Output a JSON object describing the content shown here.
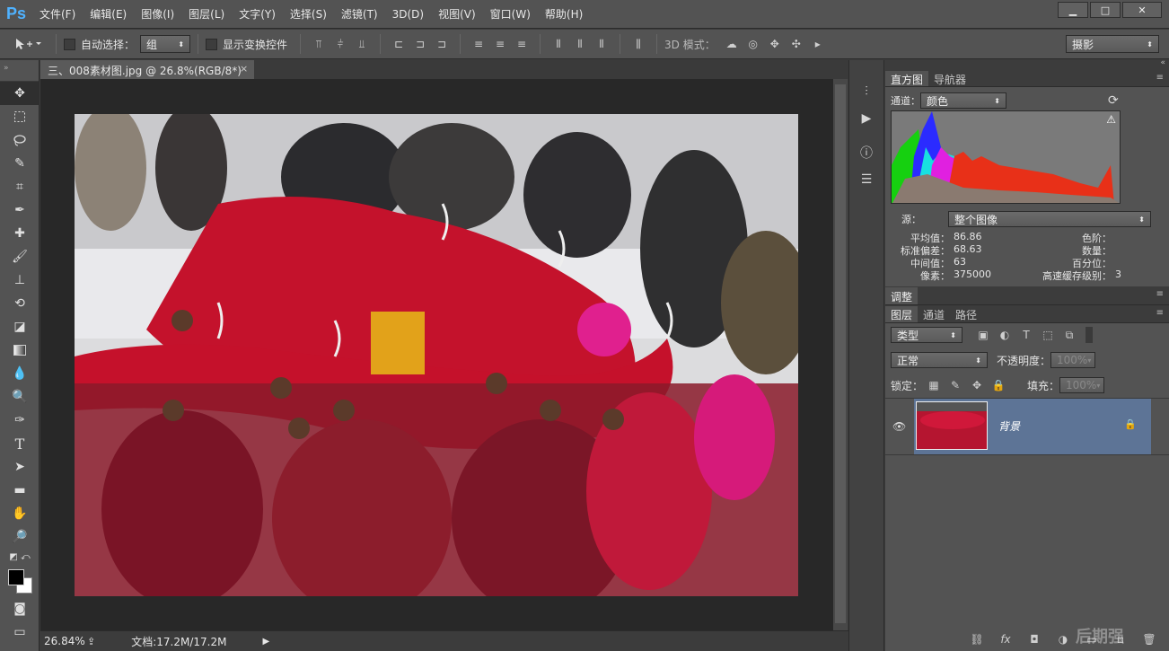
{
  "app": {
    "logo": "Ps",
    "menu": [
      "文件(F)",
      "编辑(E)",
      "图像(I)",
      "图层(L)",
      "文字(Y)",
      "选择(S)",
      "滤镜(T)",
      "3D(D)",
      "视图(V)",
      "窗口(W)",
      "帮助(H)"
    ],
    "window_controls": [
      "▁",
      "□",
      "✕"
    ]
  },
  "options": {
    "auto_select_label": "自动选择：",
    "auto_select_value": "组",
    "show_transform_label": "显示变换控件",
    "mode_3d_label": "3D 模式：",
    "workspace_value": "摄影"
  },
  "document": {
    "tab_title": "三、008素材图.jpg @ 26.8%(RGB/8*)",
    "tab_close": "×"
  },
  "status": {
    "zoom": "26.84%",
    "doc_info": "文档:17.2M/17.2M"
  },
  "histogram": {
    "tabs": [
      "直方图",
      "导航器"
    ],
    "channel_label": "通道：",
    "channel_value": "颜色",
    "source_label": "源：",
    "source_value": "整个图像",
    "stats_left": [
      {
        "label": "平均值：",
        "value": "86.86"
      },
      {
        "label": "标准偏差：",
        "value": "68.63"
      },
      {
        "label": "中间值：",
        "value": "63"
      },
      {
        "label": "像素：",
        "value": "375000"
      }
    ],
    "stats_right": [
      {
        "label": "色阶：",
        "value": ""
      },
      {
        "label": "数量：",
        "value": ""
      },
      {
        "label": "百分位：",
        "value": ""
      },
      {
        "label": "高速缓存级别：",
        "value": "3"
      }
    ]
  },
  "adjust": {
    "tab": "调整"
  },
  "layers": {
    "tabs": [
      "图层",
      "通道",
      "路径"
    ],
    "filter_value": "类型",
    "blend_value": "正常",
    "opacity_label": "不透明度：",
    "opacity_value": "100%",
    "lock_label": "锁定：",
    "fill_label": "填充：",
    "fill_value": "100%",
    "layer_name": "背景"
  },
  "watermark": "后期强"
}
